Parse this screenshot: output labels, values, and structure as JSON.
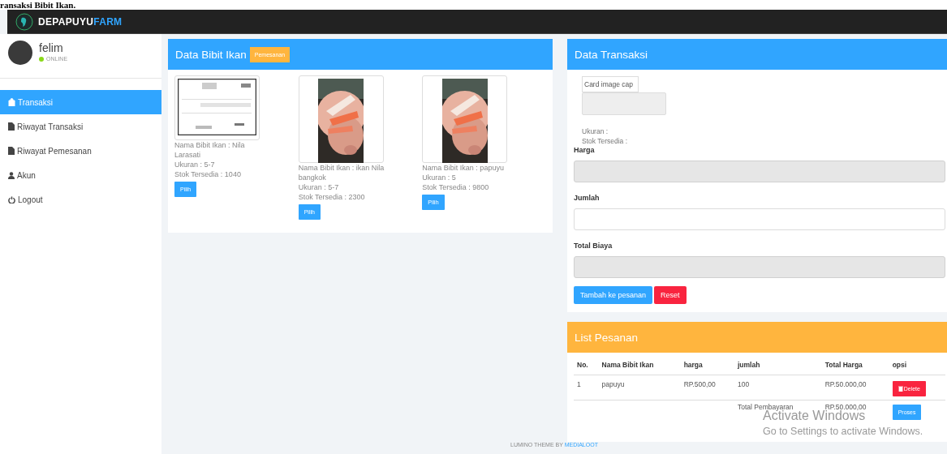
{
  "caption": "ransaksi Bibit Ikan.",
  "navbar": {
    "brand": "DEPAPUYU",
    "brand_accent": "FARM"
  },
  "profile": {
    "name": "felim",
    "status": "ONLINE",
    "online": true
  },
  "menu": [
    {
      "label": "Transaksi",
      "selected": true
    },
    {
      "label": "Riwayat Transaksi",
      "selected": false
    },
    {
      "label": "Riwayat Pemesanan",
      "selected": false
    },
    {
      "label": "Akun",
      "selected": false
    },
    {
      "label": "Logout",
      "selected": false
    }
  ],
  "products_panel": {
    "title": "Data Bibit Ikan",
    "badge": "Pemesanan",
    "items": [
      {
        "kind": "document",
        "name": "Nama Bibit Ikan : Nila Larasati",
        "size": "Ukuran : 5-7",
        "stock": "Stok Tersedia : 1040",
        "button": "Pilih"
      },
      {
        "name": "Nama Bibit Ikan : ikan Nila bangkok",
        "size": "Ukuran : 5-7",
        "stock": "Stok Tersedia : 2300",
        "button": "Pilih"
      },
      {
        "name": "Nama Bibit Ikan : papuyu",
        "size": "Ukuran : 5",
        "stock": "Stok Tersedia : 9800",
        "button": "Pilih"
      }
    ]
  },
  "transaction_panel": {
    "title": "Data Transaksi",
    "image_alt": "Card image cap",
    "size": "Ukuran :",
    "stock": "Stok Tersedia :",
    "fields": [
      {
        "label": "Harga",
        "disabled": true
      },
      {
        "label": "Jumlah",
        "disabled": false
      },
      {
        "label": "Total Biaya",
        "disabled": true
      }
    ],
    "buttons": [
      {
        "label": "Tambah ke pesanan",
        "kind": "primary"
      },
      {
        "label": "Reset",
        "kind": "danger"
      }
    ]
  },
  "order_panel": {
    "title": "List Pesanan",
    "columns": [
      "No.",
      "Nama Bibit Ikan",
      "harga",
      "jumlah",
      "Total Harga",
      "opsi"
    ],
    "rows": [
      {
        "cells": [
          "1",
          "papuyu",
          "RP.500,00",
          "100",
          "RP.50.000,00"
        ],
        "action": "Delete"
      }
    ],
    "total": {
      "label": "Total Pembayaran",
      "value": "RP.50.000,00",
      "button": "Proses"
    }
  },
  "footer": {
    "text": "LUMINO THEME BY",
    "link": "MEDIALOOT"
  },
  "os_overlay": {
    "title": "Activate Windows",
    "subtitle": "Go to Settings to activate Windows."
  }
}
